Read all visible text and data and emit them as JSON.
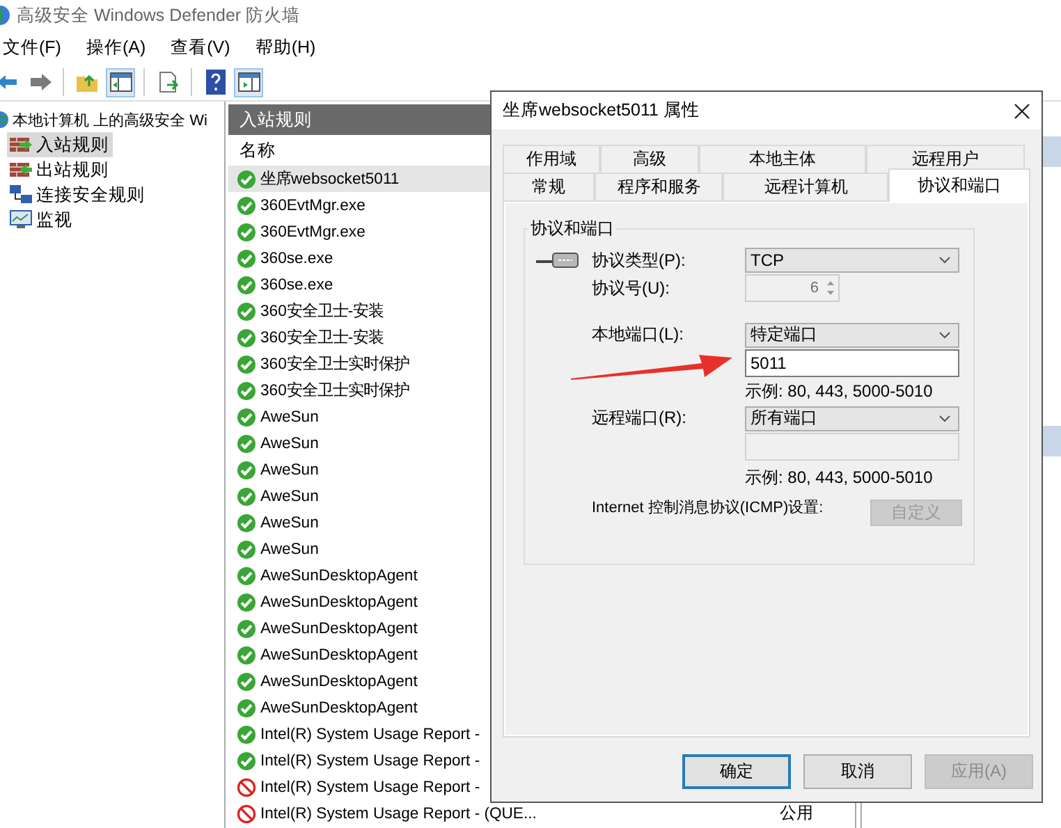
{
  "window": {
    "title": "高级安全 Windows Defender 防火墙"
  },
  "menu": [
    "文件(F)",
    "操作(A)",
    "查看(V)",
    "帮助(H)"
  ],
  "tree": {
    "root": "本地计算机 上的高级安全 Wi",
    "children": [
      {
        "label": "入站规则",
        "kind": "inbound",
        "selected": true
      },
      {
        "label": "出站规则",
        "kind": "outbound",
        "selected": false
      },
      {
        "label": "连接安全规则",
        "kind": "connection",
        "selected": false
      },
      {
        "label": "监视",
        "kind": "monitor",
        "selected": false
      }
    ]
  },
  "rules_pane": {
    "title": "入站规则",
    "columns": [
      "名称"
    ],
    "rows": [
      {
        "name": "坐席websocket5011",
        "kind": "allow",
        "selected": true
      },
      {
        "name": "360EvtMgr.exe",
        "kind": "allow",
        "selected": false
      },
      {
        "name": "360EvtMgr.exe",
        "kind": "allow",
        "selected": false
      },
      {
        "name": "360se.exe",
        "kind": "allow",
        "selected": false
      },
      {
        "name": "360se.exe",
        "kind": "allow",
        "selected": false
      },
      {
        "name": "360安全卫士-安装",
        "kind": "allow",
        "selected": false
      },
      {
        "name": "360安全卫士-安装",
        "kind": "allow",
        "selected": false
      },
      {
        "name": "360安全卫士实时保护",
        "kind": "allow",
        "selected": false
      },
      {
        "name": "360安全卫士实时保护",
        "kind": "allow",
        "selected": false
      },
      {
        "name": "AweSun",
        "kind": "allow",
        "selected": false
      },
      {
        "name": "AweSun",
        "kind": "allow",
        "selected": false
      },
      {
        "name": "AweSun",
        "kind": "allow",
        "selected": false
      },
      {
        "name": "AweSun",
        "kind": "allow",
        "selected": false
      },
      {
        "name": "AweSun",
        "kind": "allow",
        "selected": false
      },
      {
        "name": "AweSun",
        "kind": "allow",
        "selected": false
      },
      {
        "name": "AweSunDesktopAgent",
        "kind": "allow",
        "selected": false
      },
      {
        "name": "AweSunDesktopAgent",
        "kind": "allow",
        "selected": false
      },
      {
        "name": "AweSunDesktopAgent",
        "kind": "allow",
        "selected": false
      },
      {
        "name": "AweSunDesktopAgent",
        "kind": "allow",
        "selected": false
      },
      {
        "name": "AweSunDesktopAgent",
        "kind": "allow",
        "selected": false
      },
      {
        "name": "AweSunDesktopAgent",
        "kind": "allow",
        "selected": false
      },
      {
        "name": "Intel(R) System Usage Report -",
        "kind": "allow",
        "selected": false
      },
      {
        "name": "Intel(R) System Usage Report -",
        "kind": "allow",
        "selected": false
      },
      {
        "name": "Intel(R) System Usage Report -",
        "kind": "blocked",
        "selected": false
      },
      {
        "name": "Intel(R) System Usage Report - (QUE...",
        "kind": "blocked",
        "selected": false,
        "column_2": "公用"
      }
    ]
  },
  "dialog": {
    "title": "坐席websocket5011 属性",
    "tab_rows": [
      [
        {
          "label": "作用域",
          "selected": false
        },
        {
          "label": "高级",
          "selected": false
        },
        {
          "label": "本地主体",
          "selected": false
        },
        {
          "label": "远程用户",
          "selected": false
        }
      ],
      [
        {
          "label": "常规",
          "selected": false
        },
        {
          "label": "程序和服务",
          "selected": false
        },
        {
          "label": "远程计算机",
          "selected": false
        },
        {
          "label": "协议和端口",
          "selected": true
        }
      ]
    ],
    "group_title": "协议和端口",
    "protocol_type": {
      "label": "协议类型(P):",
      "value": "TCP"
    },
    "protocol_number": {
      "label": "协议号(U):",
      "value": "6",
      "disabled": true
    },
    "local_port": {
      "label": "本地端口(L):",
      "value": "特定端口",
      "ports": "5011",
      "ports_disabled": false,
      "example": "示例: 80, 443, 5000-5010"
    },
    "remote_port": {
      "label": "远程端口(R):",
      "value": "所有端口",
      "ports_disabled": true,
      "example": "示例: 80, 443, 5000-5010"
    },
    "icmp": {
      "label": "Internet 控制消息协议(ICMP)设置:",
      "button": "自定义",
      "disabled": true
    },
    "buttons": [
      {
        "label": "确定",
        "default": true,
        "disabled": false
      },
      {
        "label": "取消",
        "default": false,
        "disabled": false
      },
      {
        "label": "应用(A)",
        "default": false,
        "disabled": true
      }
    ]
  }
}
